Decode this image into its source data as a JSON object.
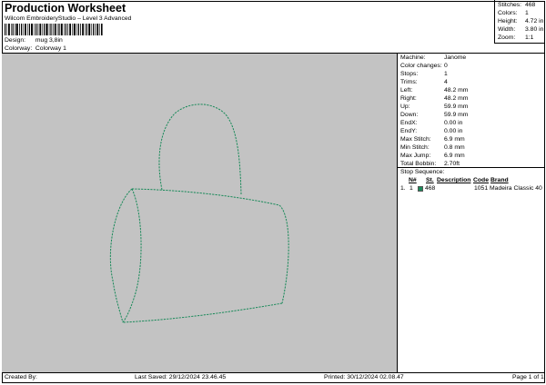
{
  "header": {
    "title": "Production Worksheet",
    "subtitle": "Wilcom EmbroideryStudio – Level 3 Advanced",
    "design_label": "Design:",
    "design_value": "mug 3,8in",
    "colorway_label": "Colorway:",
    "colorway_value": "Colorway 1"
  },
  "stats": {
    "stitches_label": "Stitches:",
    "stitches_value": "468",
    "colors_label": "Colors:",
    "colors_value": "1",
    "height_label": "Height:",
    "height_value": "4.72 in",
    "width_label": "Width:",
    "width_value": "3.80 in",
    "zoom_label": "Zoom:",
    "zoom_value": "1:1"
  },
  "info": [
    {
      "label": "Machine:",
      "value": "Janome"
    },
    {
      "label": "Color changes:",
      "value": "0"
    },
    {
      "label": "Stops:",
      "value": "1"
    },
    {
      "label": "Trims:",
      "value": "4"
    },
    {
      "label": "Left:",
      "value": "48.2 mm"
    },
    {
      "label": "Right:",
      "value": "48.2 mm"
    },
    {
      "label": "Up:",
      "value": "59.9 mm"
    },
    {
      "label": "Down:",
      "value": "59.9 mm"
    },
    {
      "label": "EndX:",
      "value": "0.00 in"
    },
    {
      "label": "EndY:",
      "value": "0.00 in"
    },
    {
      "label": "Max Stitch:",
      "value": "6.9 mm"
    },
    {
      "label": "Min Stitch:",
      "value": "0.8 mm"
    },
    {
      "label": "Max Jump:",
      "value": "6.9 mm"
    },
    {
      "label": "Total Bobbin:",
      "value": "2.70ft"
    }
  ],
  "sequence": {
    "title": "Stop Sequence:",
    "headers": {
      "n": "N#",
      "st": "St.",
      "desc": "Description",
      "code": "Code",
      "brand": "Brand"
    },
    "rows": [
      {
        "num": "1.",
        "n": "1",
        "st": "468",
        "desc": "",
        "code": "1051",
        "brand": "Madeira Classic 40",
        "color": "#1a8a5a"
      }
    ]
  },
  "footer": {
    "created_by": "Created By:",
    "last_saved": "Last Saved: 29/12/2024 23.46.45",
    "printed": "Printed: 30/12/2024 02.08.47",
    "page": "Page 1 of 1"
  },
  "design_colors": {
    "thread": "#1a8a5a",
    "canvas": "#c3c3c3"
  }
}
